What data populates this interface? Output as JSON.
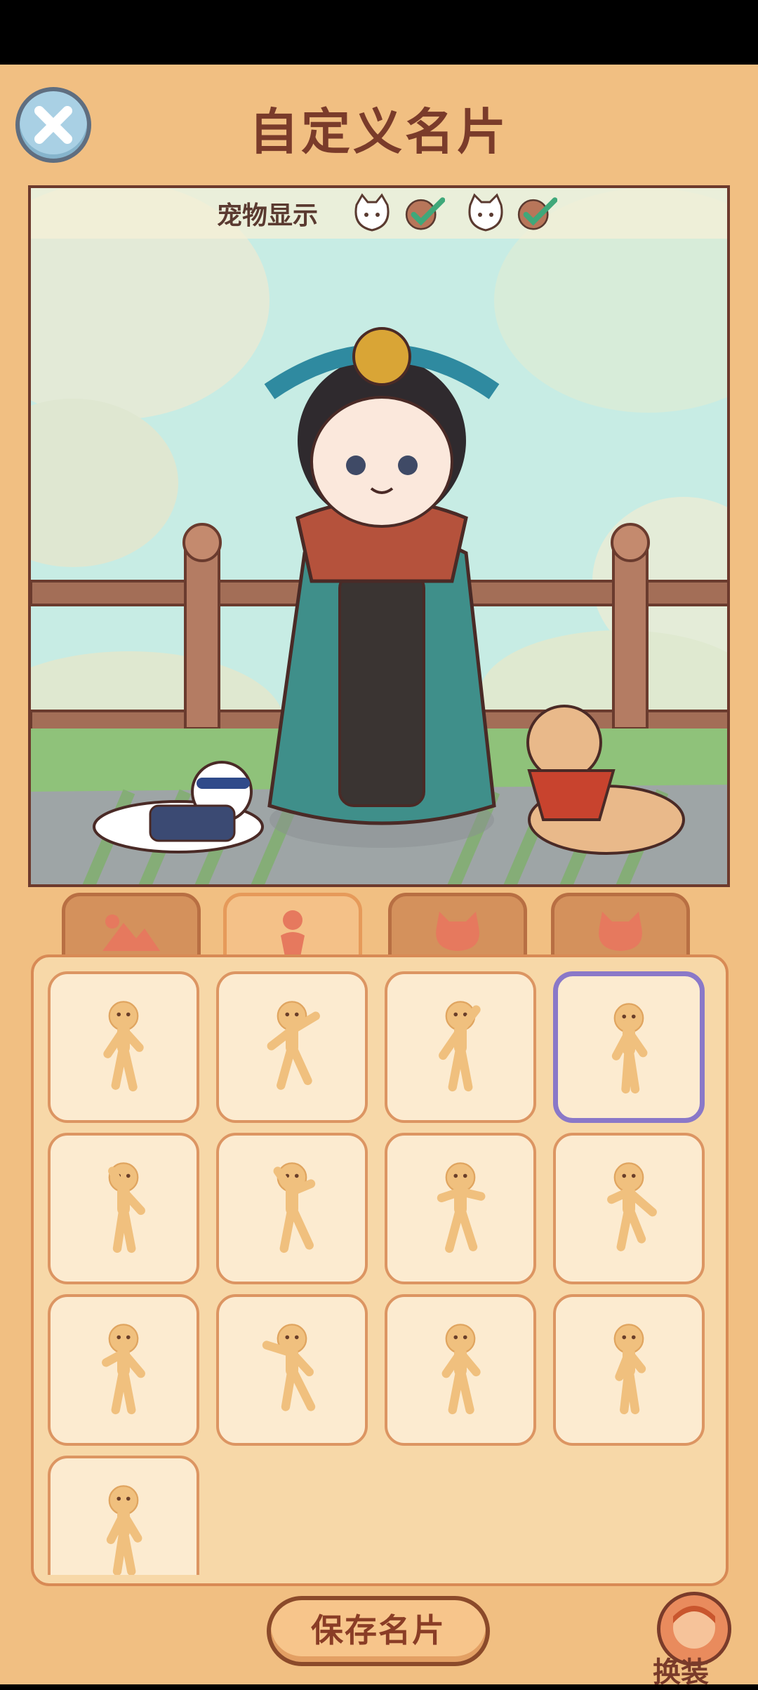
{
  "header": {
    "title": "自定义名片"
  },
  "pet_display": {
    "label": "宠物显示",
    "pet1_icon": "cat-face-icon",
    "pet1_checked": true,
    "pet2_icon": "cat-face-icon",
    "pet2_checked": true
  },
  "tabs": [
    {
      "icon": "scene-icon",
      "active": false
    },
    {
      "icon": "pose-icon",
      "active": true
    },
    {
      "icon": "pet-cat-icon",
      "active": false
    },
    {
      "icon": "pet-cat-icon",
      "active": false
    }
  ],
  "poses": {
    "count": 13,
    "selected_index": 3
  },
  "footer": {
    "save_label": "保存名片",
    "change_label": "换装"
  },
  "colors": {
    "background": "#f1bf82",
    "accent_brown": "#7a3b2a",
    "selected_border": "#8a78c8",
    "check_green": "#3fa87a"
  }
}
